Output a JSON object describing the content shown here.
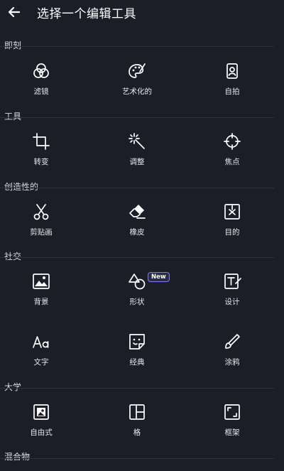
{
  "header": {
    "title": "选择一个编辑工具",
    "back_icon": "arrow-left-icon"
  },
  "sections": {
    "instant": "即刻",
    "tools": "工具",
    "creative": "创造性的",
    "social": "社交",
    "college": "大学",
    "mix": "混合物"
  },
  "items": {
    "filters": "滤镜",
    "art": "艺术化的",
    "selfie": "自拍",
    "transform": "转变",
    "adjust": "调整",
    "focus": "焦点",
    "cutout": "剪贴画",
    "eraser": "橡皮",
    "purpose": "目的",
    "background": "背景",
    "shape": "形状",
    "design": "设计",
    "text": "文字",
    "sticker": "经典",
    "doodle": "涂鸦",
    "free": "自由式",
    "grid": "格",
    "frame": "框架"
  },
  "badges": {
    "new": "New"
  },
  "colors": {
    "background": "#1b1e26",
    "divider": "#2d313b",
    "badge_border": "#7d7cf0"
  }
}
